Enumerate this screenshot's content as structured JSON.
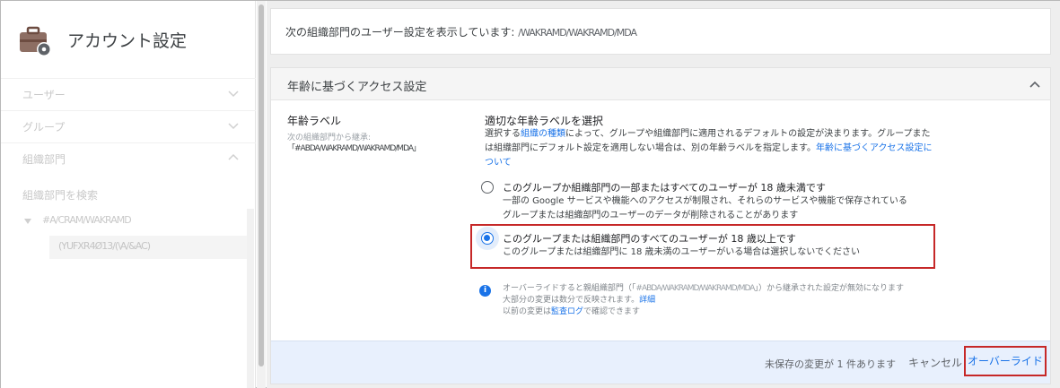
{
  "sidebar": {
    "title": "アカウント設定",
    "items": [
      {
        "label": "ユーザー"
      },
      {
        "label": "グループ"
      },
      {
        "label": "組織部門"
      }
    ],
    "search_placeholder": "組織部門を検索",
    "tree_root": "#A/CRAM/WAKRAMD",
    "tree_selected": "(YUFXR4Ø13/(\\A/&AC)"
  },
  "info": {
    "prefix": "次の組織部門のユーザー設定を表示しています:",
    "ou_name": "/WAKRAMD/WAKRAMD/MDA"
  },
  "panel": {
    "title": "年齢に基づくアクセス設定",
    "left_label": "年齢ラベル",
    "inherited_from": "次の組織部門から継承:",
    "inherited_ou": "「#ABDA/WAKRAMD/WAKRAMD/MDA」",
    "section_title": "適切な年齢ラベルを選択",
    "desc_1": "選択する",
    "desc_link_1": "組織の種類",
    "desc_2": "によって、グループや組織部門に適用されるデフォルトの設定が決まります。グループまたは組織部門にデフォルト設定を適用しない場合は、別の年齢ラベルを指定します。",
    "desc_link_2": "年齢に基づくアクセス設定について",
    "options": [
      {
        "label": "このグループか組織部門の一部またはすべてのユーザーが 18 歳未満です",
        "sub_1": "一部の Google サービスや機能へのアクセスが制限され、それらのサービスや機能で保存されている",
        "sub_2": "グループまたは組織部門のユーザーのデータが削除されることがあります",
        "checked": false
      },
      {
        "label": "このグループまたは組織部門のすべてのユーザーが 18 歳以上です",
        "sub_1": "このグループまたは組織部門に 18 歳未満のユーザーがいる場合は選択しないでください",
        "checked": true
      }
    ],
    "note_1a": "オーバーライドすると親組織部門（「",
    "note_1_ou": "#ABDA/WAKRAMD/WAKRAMD/MDA",
    "note_1b": "」）から継承された設定が無効になります",
    "note_2": "大部分の変更は数分で反映されます。",
    "note_2_link": "詳細",
    "note_3a": "以前の変更は",
    "note_3_link": "監査ログ",
    "note_3b": "で確認できます"
  },
  "footer": {
    "unsaved": "未保存の変更が 1 件あります",
    "cancel": "キャンセル",
    "override": "オーバーライド"
  },
  "colors": {
    "accent": "#1a73e8",
    "highlight_border": "#c62828",
    "footer_bg": "#e8f0fd"
  }
}
